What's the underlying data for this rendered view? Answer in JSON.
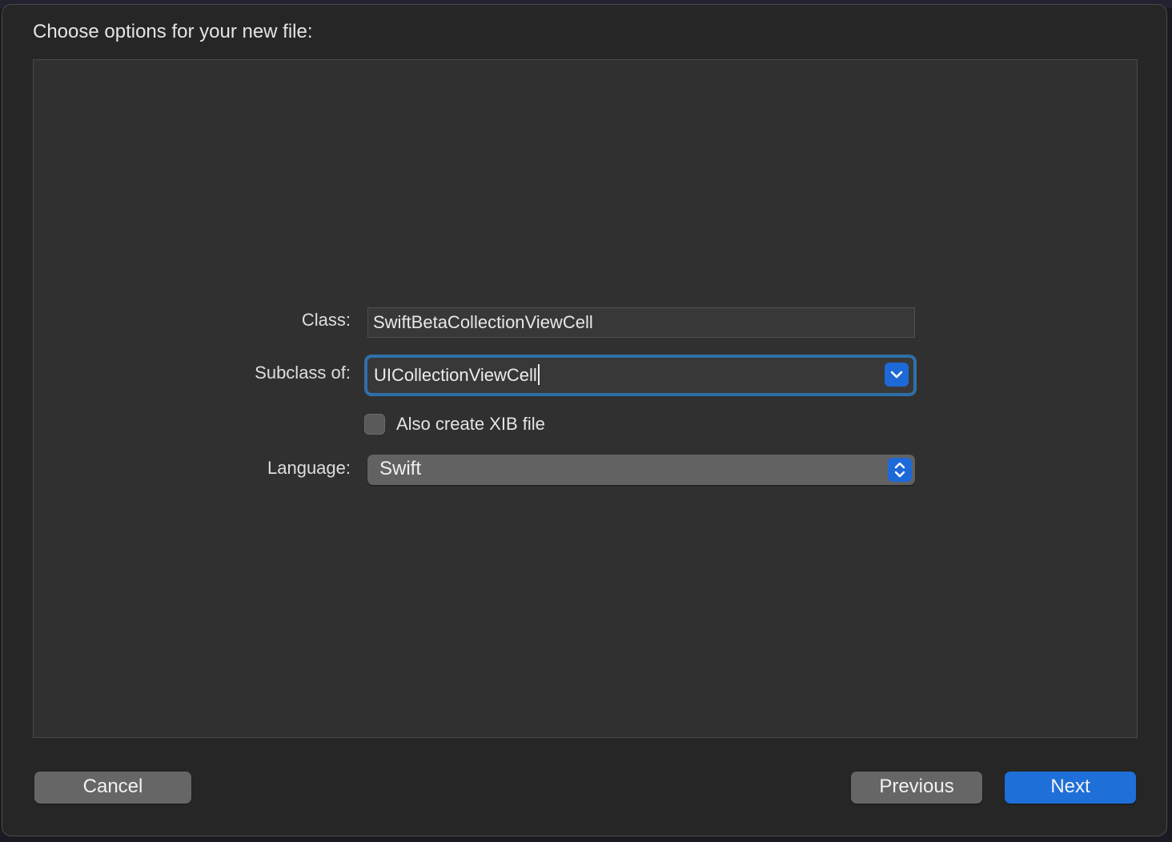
{
  "sheet": {
    "title": "Choose options for your new file:"
  },
  "form": {
    "class_label": "Class:",
    "class_value": "SwiftBetaCollectionViewCell",
    "subclass_label": "Subclass of:",
    "subclass_value": "UICollectionViewCell",
    "xib_checkbox_label": "Also create XIB file",
    "xib_checked": false,
    "language_label": "Language:",
    "language_value": "Swift"
  },
  "buttons": {
    "cancel": "Cancel",
    "previous": "Previous",
    "next": "Next"
  },
  "colors": {
    "accent": "#1f6fd8",
    "focus_ring": "#2f6fa8",
    "sheet_bg": "#262626",
    "panel_bg": "#303030"
  },
  "icons": {
    "subclass_dropdown": "chevron-down-icon",
    "language_popup": "chevron-up-down-icon"
  }
}
